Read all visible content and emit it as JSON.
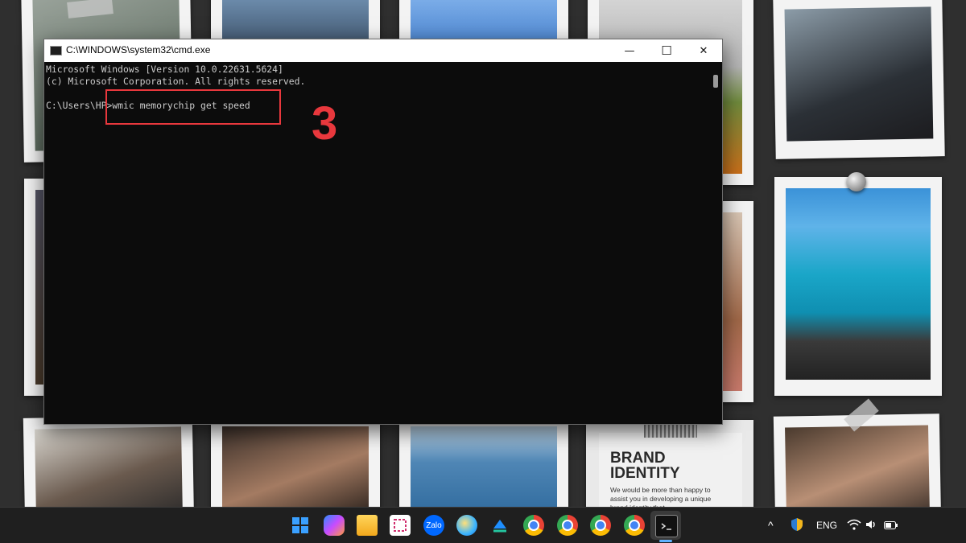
{
  "window": {
    "title": "C:\\WINDOWS\\system32\\cmd.exe",
    "minimize_glyph": "—",
    "maximize_glyph": "☐",
    "close_glyph": "✕"
  },
  "console": {
    "lines": [
      "Microsoft Windows [Version 10.0.22631.5624]",
      "(c) Microsoft Corporation. All rights reserved.",
      "",
      "C:\\Users\\HP>wmic memorychip get speed"
    ]
  },
  "annotation": {
    "step_number": "3",
    "color": "#e8383d"
  },
  "poster": {
    "title_line1": "BRAND",
    "title_line2": "IDENTITY",
    "body": "We would be more than happy to assist you in developing a unique brand identity that"
  },
  "taskbar": {
    "icons": [
      "windows-start-icon",
      "copilot-icon",
      "file-explorer-icon",
      "snipping-tool-icon",
      "zalo-icon",
      "paint-icon",
      "app-icon",
      "chrome-icon",
      "chrome-profile-icon",
      "chrome-profile-icon",
      "chrome-profile-icon",
      "terminal-icon"
    ],
    "zalo_label": "Zalo",
    "language": "ENG",
    "chevron": "^"
  }
}
